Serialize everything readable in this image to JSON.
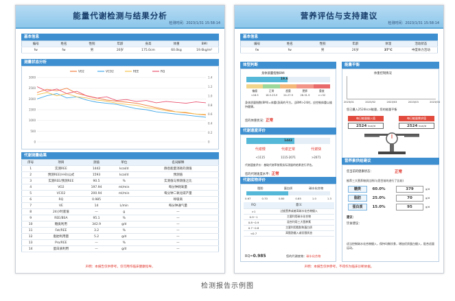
{
  "report1": {
    "title": "能量代谢检测与结果分析",
    "time": "检测时间：2023/1/31 15:58:14",
    "basic": {
      "heading": "基本信息",
      "headers": [
        "编号",
        "姓名",
        "性别",
        "年龄",
        "身高",
        "体重",
        "BMI"
      ],
      "values": [
        "fw",
        "fw",
        "男",
        "26岁",
        "175.0cm",
        "60.0kg",
        "19.6kg/m²"
      ]
    },
    "chart": {
      "heading": "测量状态分析",
      "legend": [
        "VO2",
        "VCO2",
        "REE",
        "RQ"
      ],
      "colors": [
        "#f07a3c",
        "#3fa7e8",
        "#f4c04a",
        "#e9506d"
      ],
      "yleft": [
        "3000",
        "2500",
        "2000",
        "1500",
        "1000",
        "500",
        "0"
      ],
      "yright": [
        "1.4",
        "1.2",
        "1.0",
        "0.8",
        "0.6",
        "0.4",
        "0.2",
        "0"
      ]
    },
    "metrics": {
      "heading": "代谢测量结果",
      "headers": [
        "序号",
        "项目",
        "测值",
        "单位",
        "名词解释"
      ],
      "rows": [
        [
          "1",
          "实测REE",
          "1442",
          "kcal/d",
          "静息能量消耗的测值"
        ],
        [
          "2",
          "预测REE(H-B)公式",
          "1593",
          "kcal/d",
          "预测值"
        ],
        [
          "3",
          "实测REE/预测REE",
          "90.5",
          "%",
          "实测值与预测值之比"
        ],
        [
          "4",
          "VO2",
          "197.94",
          "ml/min",
          "每分钟耗氧量"
        ],
        [
          "5",
          "VCO2",
          "200.94",
          "ml/min",
          "每分钟二氧化碳产量"
        ],
        [
          "6",
          "RQ",
          "0.985",
          "",
          "呼吸商"
        ],
        [
          "7",
          "VE",
          "14",
          "L/min",
          "每分钟通气量"
        ],
        [
          "8",
          "24小时底值",
          "—",
          "g",
          "—"
        ],
        [
          "9",
          "REE/BSA",
          "95.1",
          "%",
          "—"
        ],
        [
          "10",
          "糖类利用",
          "342.9",
          "g/d",
          "—"
        ],
        [
          "11",
          "Fat/REE",
          "3.2",
          "%",
          "—"
        ],
        [
          "12",
          "脂肪利用量",
          "5.2",
          "g/d",
          "—"
        ],
        [
          "13",
          "Pro/REE",
          "—",
          "%",
          "—"
        ],
        [
          "14",
          "蛋白质利用",
          "—",
          "g/d",
          "—"
        ]
      ]
    },
    "footer": "声明：本报告仅供参考，仅可用作临床健康指导。"
  },
  "report2": {
    "title": "营养评估与支持建议",
    "time": "检测时间：2023/1/31 15:58:14",
    "basic": {
      "heading": "基本信息",
      "headers": [
        "编号",
        "姓名",
        "性别",
        "年龄",
        "体温",
        "活动状态"
      ],
      "values": [
        "fw",
        "fw",
        "男",
        "26岁",
        "37°C",
        "中度体力活动"
      ]
    },
    "body": {
      "heading": "体型判断",
      "bmi_label": "身体质量指数BMI",
      "bmi_value": "19.6",
      "scale_labels": [
        "偏瘦",
        "正常",
        "超重",
        "肥胖",
        "重度"
      ],
      "scale_ranges": [
        "<18.5",
        "18.5-23.9",
        "24-27.9",
        "28-31.9",
        ">=32"
      ],
      "note": "身体质量指数(BMI)=体重/身高的平方。当BMI>24时，应控制体重以维持健康。",
      "result_label": "您的体重状况：",
      "result_value": "正常"
    },
    "balance": {
      "heading": "能量平衡",
      "chart_title": "体重控制情况",
      "dates": [
        "2023/01",
        "2023/02",
        "2023/03",
        "2023/03",
        "2023/04"
      ],
      "note": "您已摄入2524kcal能量，您的能量平衡",
      "intake_label": "每日能量摄入值",
      "intake_value": "2524",
      "need_label": "每日能量需求值",
      "need_value": "2524",
      "unit": "kcal/d"
    },
    "metab": {
      "heading": "代谢速度评价",
      "value": "1442",
      "labels": [
        "代谢慢",
        "代谢正常",
        "代谢快"
      ],
      "ranges": [
        "<1115",
        "1115-2071",
        ">2071"
      ],
      "note": "代谢速度评价：基础代谢率按照实际测量的结果进行评估。",
      "result_label": "您的代谢速度水平：",
      "result_value": "正常"
    },
    "fuel": {
      "heading": "代谢底物评价",
      "labels": [
        "脂肪",
        "蛋白质",
        "碳水化合物"
      ],
      "ticks": [
        "0.67",
        "0.70",
        "0.80",
        "0.85",
        "1.0",
        "1.3"
      ],
      "rq_header": [
        "RQ",
        "意义"
      ],
      "rq_rows": [
        [
          ">1",
          "过度营养或者高碳水化合物摄入"
        ],
        [
          "0.9~1",
          "主要利用碳水化合物"
        ],
        [
          "0.8~0.9",
          "混合利用三大营养素"
        ],
        [
          "0.7~0.8",
          "主要利用脂肪和蛋白质"
        ],
        [
          "<0.7",
          "高脂肪摄入或饥饿状态"
        ]
      ],
      "rq_label": "RQ=",
      "rq_value": "0.985",
      "result_label": "您的代谢底物：",
      "result_value": "碳水化合物"
    },
    "supply": {
      "heading": "营养素供给建议",
      "intro_label": "您当前的健康状态：",
      "intro_value": "正常",
      "desc": "推荐三大营养物质比例(与您目前的进行了比较)",
      "items": [
        {
          "name": "糖类",
          "pct": "60.0%",
          "grams": "379",
          "unit": "g/d"
        },
        {
          "name": "脂肪",
          "pct": "25.0%",
          "grams": "70",
          "unit": "g/d"
        },
        {
          "name": "蛋白质",
          "pct": "15.0%",
          "grams": "95",
          "unit": "g/d"
        }
      ],
      "advice_heading": "建议：",
      "advice_sub": "饮食建议：",
      "advice": "适当控制碳水化合物摄入，保持均衡饮食，增加优质蛋白摄入，配合适量运动。"
    },
    "footer": "声明：本报告仅供参考，不得作为临床诊断依据。"
  },
  "caption": "检测报告示例图",
  "chart_data": {
    "type": "line",
    "legend": [
      "VO2",
      "VCO2",
      "REE",
      "RQ"
    ],
    "ylim_left": [
      0,
      3000
    ],
    "ylim_right": [
      0,
      1.4
    ],
    "grid": true,
    "legend_position": "top",
    "series": [
      {
        "name": "VO2",
        "values": [
          2300,
          2450,
          2380,
          2500,
          2260,
          2150,
          2050,
          1950,
          1900,
          1850,
          1800,
          1700,
          1600,
          1500,
          1400,
          1350,
          1300,
          1250
        ]
      },
      {
        "name": "VCO2",
        "values": [
          2000,
          2150,
          2250,
          2050,
          2100,
          1950,
          1850,
          1800,
          1750,
          1650,
          1550,
          1500,
          1400,
          1350,
          1300,
          1250,
          1200,
          1150
        ]
      },
      {
        "name": "REE",
        "values": [
          2200,
          2300,
          2150,
          2250,
          2100,
          2050,
          1950,
          1900,
          1800,
          1750,
          1700,
          1600,
          1550,
          1450,
          1400,
          1380,
          1300,
          1280
        ]
      },
      {
        "name": "RQ",
        "values": [
          1.2,
          1.1,
          1.15,
          1.05,
          1.1,
          1.0,
          0.95,
          0.98,
          0.9,
          0.92,
          0.88,
          0.9,
          0.85,
          0.88,
          0.86,
          0.84,
          0.87,
          0.85
        ]
      }
    ]
  }
}
